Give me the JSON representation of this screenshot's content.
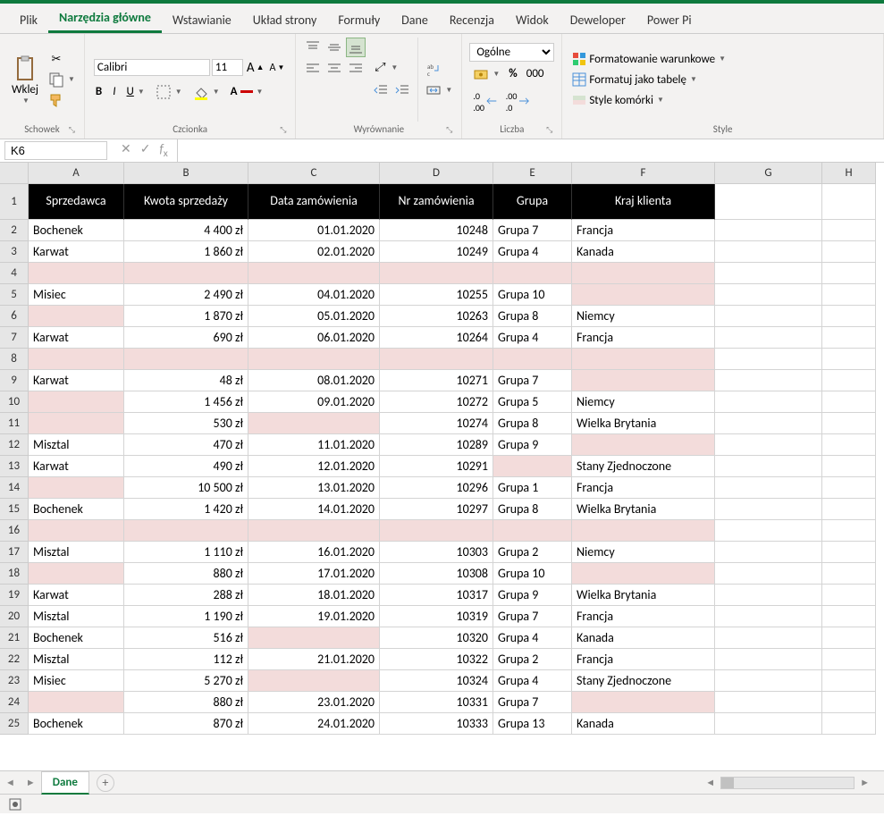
{
  "tabs": [
    "Plik",
    "Narzędzia główne",
    "Wstawianie",
    "Układ strony",
    "Formuły",
    "Dane",
    "Recenzja",
    "Widok",
    "Deweloper",
    "Power Pi"
  ],
  "activeTab": 1,
  "ribbon": {
    "clipboard": {
      "label": "Schowek",
      "paste": "Wklej"
    },
    "font": {
      "label": "Czcionka",
      "name": "Calibri",
      "size": "11"
    },
    "alignment": {
      "label": "Wyrównanie"
    },
    "number": {
      "label": "Liczba",
      "format": "Ogólne",
      "thousands": "000"
    },
    "styles": {
      "label": "Style",
      "cond": "Formatowanie warunkowe",
      "table": "Formatuj jako tabelę",
      "cell": "Style komórki"
    }
  },
  "namebox": "K6",
  "columns": [
    "A",
    "B",
    "C",
    "D",
    "E",
    "F",
    "G",
    "H"
  ],
  "headers": [
    "Sprzedawca",
    "Kwota sprzedaży",
    "Data zamówienia",
    "Nr zamówienia",
    "Grupa",
    "Kraj klienta"
  ],
  "rows": [
    {
      "n": 2,
      "c": [
        "Bochenek",
        "4 400 zł",
        "01.01.2020",
        "10248",
        "Grupa 7",
        "Francja"
      ],
      "p": []
    },
    {
      "n": 3,
      "c": [
        "Karwat",
        "1 860 zł",
        "02.01.2020",
        "10249",
        "Grupa 4",
        "Kanada"
      ],
      "p": []
    },
    {
      "n": 4,
      "c": [
        "",
        "",
        "",
        "",
        "",
        ""
      ],
      "p": [
        0,
        1,
        2,
        3,
        4,
        5
      ]
    },
    {
      "n": 5,
      "c": [
        "Misiec",
        "2 490 zł",
        "04.01.2020",
        "10255",
        "Grupa 10",
        ""
      ],
      "p": [
        5
      ]
    },
    {
      "n": 6,
      "c": [
        "",
        "1 870 zł",
        "05.01.2020",
        "10263",
        "Grupa 8",
        "Niemcy"
      ],
      "p": [
        0
      ]
    },
    {
      "n": 7,
      "c": [
        "Karwat",
        "690 zł",
        "06.01.2020",
        "10264",
        "Grupa 4",
        "Francja"
      ],
      "p": []
    },
    {
      "n": 8,
      "c": [
        "",
        "",
        "",
        "",
        "",
        ""
      ],
      "p": [
        0,
        1,
        2,
        3,
        4,
        5
      ]
    },
    {
      "n": 9,
      "c": [
        "Karwat",
        "48 zł",
        "08.01.2020",
        "10271",
        "Grupa 7",
        ""
      ],
      "p": [
        5
      ]
    },
    {
      "n": 10,
      "c": [
        "",
        "1 456 zł",
        "09.01.2020",
        "10272",
        "Grupa 5",
        "Niemcy"
      ],
      "p": [
        0
      ]
    },
    {
      "n": 11,
      "c": [
        "",
        "530 zł",
        "",
        "10274",
        "Grupa 8",
        "Wielka Brytania"
      ],
      "p": [
        0,
        2
      ]
    },
    {
      "n": 12,
      "c": [
        "Misztal",
        "470 zł",
        "11.01.2020",
        "10289",
        "Grupa 9",
        ""
      ],
      "p": [
        5
      ]
    },
    {
      "n": 13,
      "c": [
        "Karwat",
        "490 zł",
        "12.01.2020",
        "10291",
        "",
        "Stany Zjednoczone"
      ],
      "p": [
        4
      ]
    },
    {
      "n": 14,
      "c": [
        "",
        "10 500 zł",
        "13.01.2020",
        "10296",
        "Grupa 1",
        "Francja"
      ],
      "p": [
        0
      ]
    },
    {
      "n": 15,
      "c": [
        "Bochenek",
        "1 420 zł",
        "14.01.2020",
        "10297",
        "Grupa 8",
        "Wielka Brytania"
      ],
      "p": []
    },
    {
      "n": 16,
      "c": [
        "",
        "",
        "",
        "",
        "",
        ""
      ],
      "p": [
        0,
        1,
        2,
        3,
        4,
        5
      ]
    },
    {
      "n": 17,
      "c": [
        "Misztal",
        "1 110 zł",
        "16.01.2020",
        "10303",
        "Grupa 2",
        "Niemcy"
      ],
      "p": []
    },
    {
      "n": 18,
      "c": [
        "",
        "880 zł",
        "17.01.2020",
        "10308",
        "Grupa 10",
        ""
      ],
      "p": [
        0,
        5
      ]
    },
    {
      "n": 19,
      "c": [
        "Karwat",
        "288 zł",
        "18.01.2020",
        "10317",
        "Grupa 9",
        "Wielka Brytania"
      ],
      "p": []
    },
    {
      "n": 20,
      "c": [
        "Misztal",
        "1 190 zł",
        "19.01.2020",
        "10319",
        "Grupa 7",
        "Francja"
      ],
      "p": []
    },
    {
      "n": 21,
      "c": [
        "Bochenek",
        "516 zł",
        "",
        "10320",
        "Grupa 4",
        "Kanada"
      ],
      "p": [
        2
      ]
    },
    {
      "n": 22,
      "c": [
        "Misztal",
        "112 zł",
        "21.01.2020",
        "10322",
        "Grupa 2",
        "Francja"
      ],
      "p": []
    },
    {
      "n": 23,
      "c": [
        "Misiec",
        "5 270 zł",
        "",
        "10324",
        "Grupa 4",
        "Stany Zjednoczone"
      ],
      "p": [
        2
      ]
    },
    {
      "n": 24,
      "c": [
        "",
        "880 zł",
        "23.01.2020",
        "10331",
        "Grupa 7",
        ""
      ],
      "p": [
        0,
        5
      ]
    },
    {
      "n": 25,
      "c": [
        "Bochenek",
        "870 zł",
        "24.01.2020",
        "10333",
        "Grupa 13",
        "Kanada"
      ],
      "p": []
    }
  ],
  "sheetTab": "Dane"
}
